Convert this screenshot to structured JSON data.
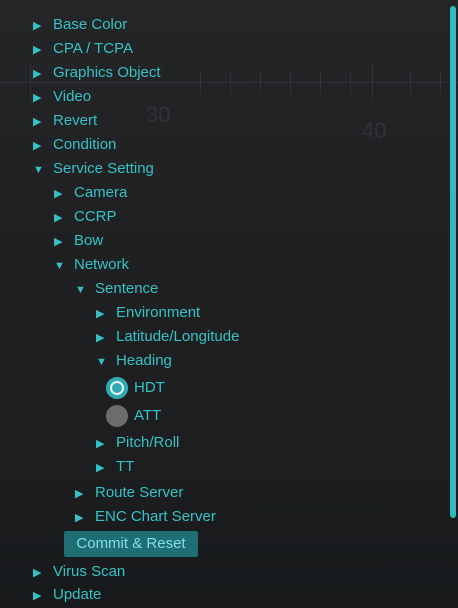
{
  "overlay": {
    "scale_30": "30",
    "scale_40": "40"
  },
  "tree": {
    "base_color": {
      "arrow": "▶",
      "label": "Base Color"
    },
    "cpa_tcpa": {
      "arrow": "▶",
      "label": "CPA / TCPA"
    },
    "graphics_object": {
      "arrow": "▶",
      "label": "Graphics Object"
    },
    "video": {
      "arrow": "▶",
      "label": "Video"
    },
    "revert": {
      "arrow": "▶",
      "label": "Revert"
    },
    "condition": {
      "arrow": "▶",
      "label": "Condition"
    },
    "service_setting": {
      "arrow": "▼",
      "label": "Service Setting"
    },
    "camera": {
      "arrow": "▶",
      "label": "Camera"
    },
    "ccrp": {
      "arrow": "▶",
      "label": "CCRP"
    },
    "bow": {
      "arrow": "▶",
      "label": "Bow"
    },
    "network": {
      "arrow": "▼",
      "label": "Network"
    },
    "sentence": {
      "arrow": "▼",
      "label": "Sentence"
    },
    "environment": {
      "arrow": "▶",
      "label": "Environment"
    },
    "lat_long": {
      "arrow": "▶",
      "label": "Latitude/Longitude"
    },
    "heading": {
      "arrow": "▼",
      "label": "Heading"
    },
    "hdt": {
      "label": "HDT",
      "selected": true
    },
    "att": {
      "label": "ATT",
      "selected": false
    },
    "pitch_roll": {
      "arrow": "▶",
      "label": "Pitch/Roll"
    },
    "tt": {
      "arrow": "▶",
      "label": "TT"
    },
    "route_server": {
      "arrow": "▶",
      "label": "Route Server"
    },
    "enc_chart_server": {
      "arrow": "▶",
      "label": "ENC Chart Server"
    },
    "commit_reset": "Commit & Reset",
    "virus_scan": {
      "arrow": "▶",
      "label": "Virus Scan"
    },
    "update": {
      "arrow": "▶",
      "label": "Update"
    }
  },
  "colors": {
    "accent": "#35c2c6",
    "button_bg": "#1f6e73",
    "radio_on": "#2ea9ad",
    "radio_off": "#6a6c6e"
  }
}
